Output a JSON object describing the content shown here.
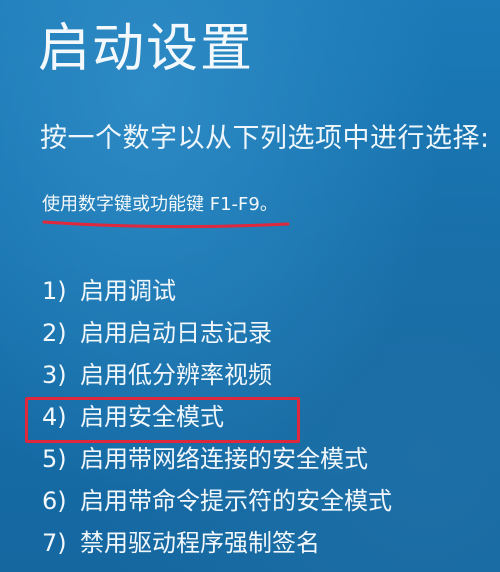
{
  "title": "启动设置",
  "instruction": "按一个数字以从下列选项中进行选择:",
  "hint": "使用数字键或功能键 F1-F9。",
  "options": [
    {
      "num": "1)",
      "label": "启用调试"
    },
    {
      "num": "2)",
      "label": "启用启动日志记录"
    },
    {
      "num": "3)",
      "label": "启用低分辨率视频"
    },
    {
      "num": "4)",
      "label": "启用安全模式"
    },
    {
      "num": "5)",
      "label": "启用带网络连接的安全模式"
    },
    {
      "num": "6)",
      "label": "启用带命令提示符的安全模式"
    },
    {
      "num": "7)",
      "label": "禁用驱动程序强制签名"
    }
  ],
  "colors": {
    "background": "#1670ab",
    "text": "#eef6fb",
    "annotation": "#e0283c"
  }
}
